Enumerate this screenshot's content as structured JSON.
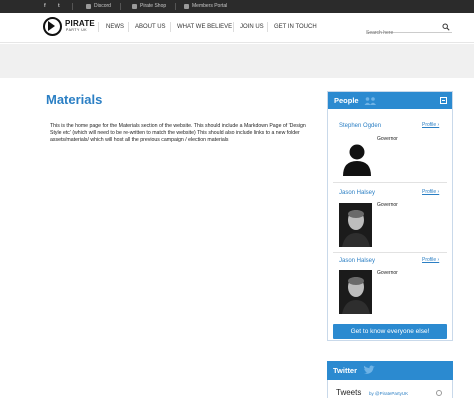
{
  "topbar": {
    "social_f": "f",
    "social_t": "t",
    "discord": "Discord",
    "shop": "Pirate Shop",
    "members": "Members Portal"
  },
  "logo": {
    "name": "PIRATE",
    "sub": "PARTY UK"
  },
  "nav": {
    "items": [
      "NEWS",
      "ABOUT US",
      "WHAT WE BELIEVE",
      "JOIN US",
      "GET IN TOUCH"
    ],
    "search_placeholder": "Search here"
  },
  "page": {
    "title": "Materials",
    "body": "This is the home page for the Materials section of the website. This should include a Markdown Page of 'Design Style etc' (which will need to be re-written to match the website) This should also include links to a new folder assets/materials/ which will host all the previous campaign / election materials"
  },
  "people_panel": {
    "title": "People",
    "people": [
      {
        "name": "Stephen Ogden",
        "role": "Governor",
        "link": "Profile ›",
        "photo": "silhouette"
      },
      {
        "name": "Jason Halsey",
        "role": "Governor",
        "link": "Profile ›",
        "photo": "portrait"
      },
      {
        "name": "Jason Halsey",
        "role": "Governor",
        "link": "Profile ›",
        "photo": "portrait"
      }
    ],
    "cta": "Get to know everyone else!"
  },
  "twitter_panel": {
    "title": "Twitter",
    "tweets_label": "Tweets",
    "tweets_by": "by @PiratePartyUK"
  },
  "colors": {
    "accent": "#2b8ad0",
    "link": "#2b7fc4",
    "topbar": "#2b2b2b",
    "banner": "#f0f0f0"
  }
}
